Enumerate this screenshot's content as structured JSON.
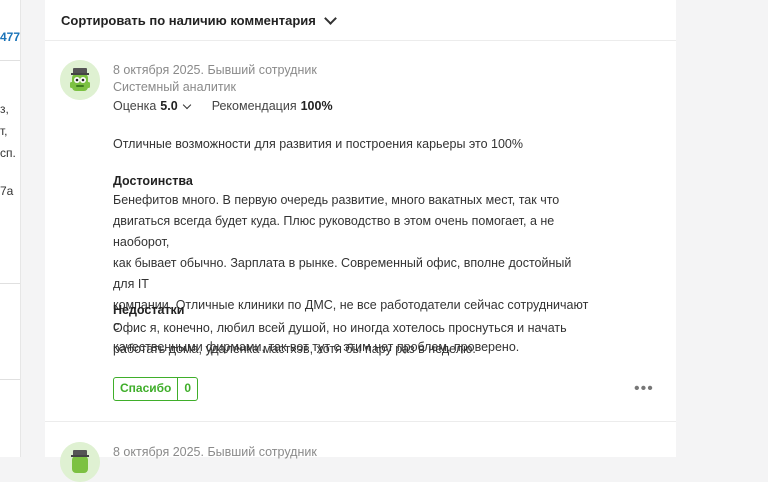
{
  "left_column": {
    "fragments": [
      "477",
      "з,",
      "т,",
      "сп.",
      "7а"
    ]
  },
  "sort": {
    "label": "Сортировать по наличию комментария"
  },
  "reviews": [
    {
      "date_status": "8 октября 2025. Бывший сотрудник",
      "position": "Системный аналитик",
      "rating_label": "Оценка",
      "rating_value": "5.0",
      "recommend_label": "Рекомендация",
      "recommend_value": "100%",
      "summary": "Отличные возможности для развития и построения карьеры это 100%",
      "pros_title": "Достоинства",
      "pros_lines": [
        "Бенефитов много. В первую очередь развитие, много вакатных мест, так что",
        "двигаться всегда будет куда. Плюс руководство в этом очень помогает, а не наоборот,",
        "как бывает обычно. Зарплата в рынке. Современный офис, вполне достойный для IT",
        "компании. Отличные клиники по ДМС, не все работодатели сейчас сотрудничают с",
        "качественными фирмами, так вот тут с этим нет проблем, проверено."
      ],
      "cons_title": "Недостатки",
      "cons_lines": [
        "Офис я, конечно, любил всей душой, но иногда хотелось проснуться и начать",
        "работать дома, удаленка мастхэв, хотя бы пару раз в неделю."
      ],
      "thanks_label": "Спасибо",
      "thanks_count": "0",
      "more": "•••"
    },
    {
      "date_status": "8 октября 2025. Бывший сотрудник"
    }
  ],
  "colors": {
    "accent_green": "#3fae2a",
    "link_blue": "#1a73b8"
  },
  "icons": {
    "avatar": "green-monster-avatar-icon",
    "sort_chevron": "chevron-down-icon",
    "more": "more-dots-icon"
  }
}
